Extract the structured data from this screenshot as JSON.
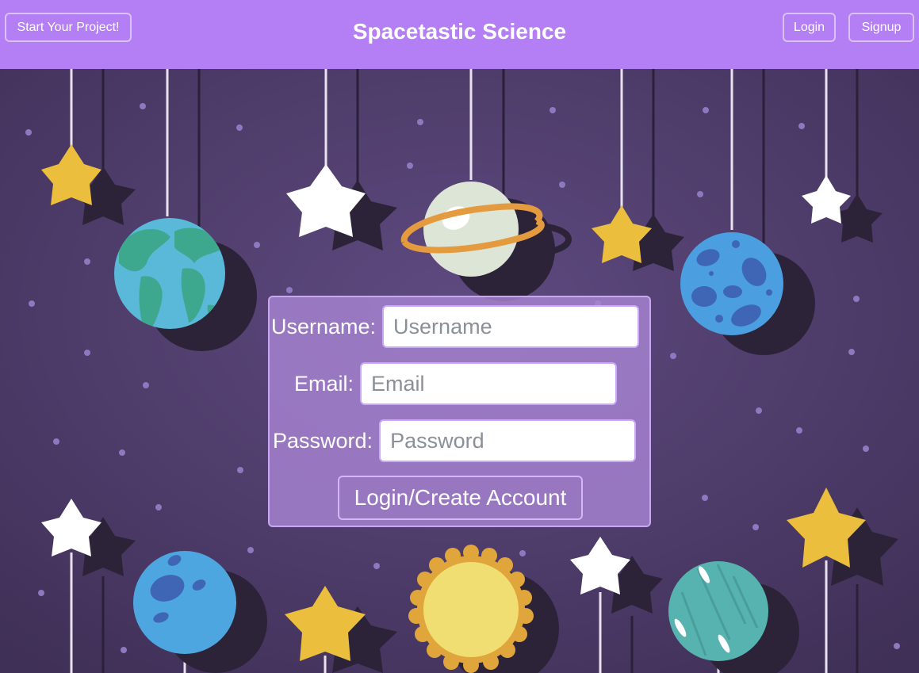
{
  "header": {
    "title": "Spacetastic Science",
    "start_project_label": "Start Your Project!",
    "login_label": "Login",
    "signup_label": "Signup",
    "background_color": "#b47ef5"
  },
  "form": {
    "username_label": "Username:",
    "username_placeholder": "Username",
    "email_label": "Email:",
    "email_placeholder": "Email",
    "password_label": "Password:",
    "password_placeholder": "Password",
    "submit_label": "Login/Create Account"
  },
  "scene": {
    "background_color": "#4a3863",
    "decorations": [
      "star",
      "earth-planet",
      "ringed-planet",
      "blue-cratered-planet",
      "sun",
      "teal-planet"
    ]
  }
}
